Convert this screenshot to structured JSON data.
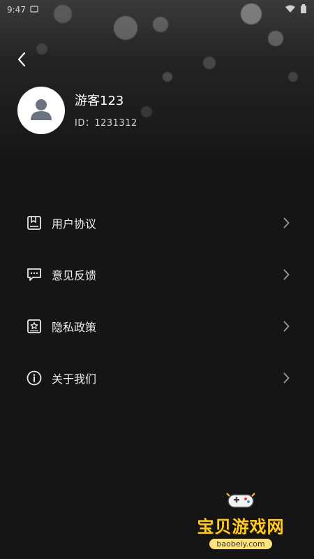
{
  "status_bar": {
    "time": "9:47",
    "battery_icon": "battery-icon",
    "wifi_icon": "wifi-icon"
  },
  "header": {
    "back_icon": "chevron-left-icon"
  },
  "profile": {
    "username": "游客123",
    "id_text": "ID：1231312",
    "avatar_icon": "user-avatar-icon"
  },
  "menu": {
    "items": [
      {
        "label": "用户协议",
        "icon": "document-icon"
      },
      {
        "label": "意见反馈",
        "icon": "message-icon"
      },
      {
        "label": "隐私政策",
        "icon": "star-book-icon"
      },
      {
        "label": "关于我们",
        "icon": "info-icon"
      }
    ]
  },
  "watermark": {
    "title": "宝贝游戏网",
    "url": "baobeiy.com"
  },
  "colors": {
    "background": "#151515",
    "text": "#ededed",
    "watermark": "#ffcc22"
  }
}
